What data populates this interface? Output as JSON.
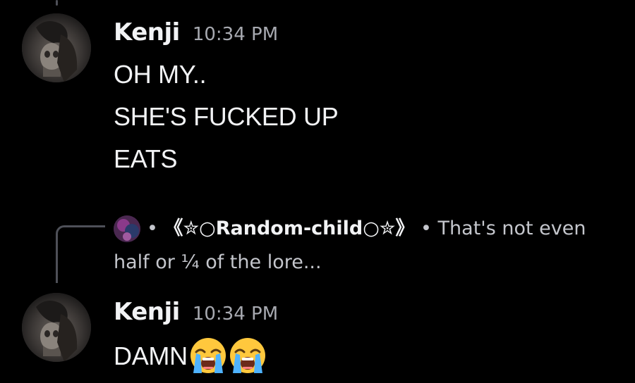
{
  "messages": [
    {
      "username": "Kenji",
      "timestamp": "10:34 PM",
      "lines": [
        "OH MY..",
        "SHE'S FUCKED UP",
        "EATS"
      ]
    },
    {
      "reply": {
        "prefix": "•",
        "name": "《✮○Random-child○✮》",
        "separator": "•",
        "text_part1": "That's not even",
        "text_part2": "half or ¼ of the lore..."
      },
      "username": "Kenji",
      "timestamp": "10:34 PM",
      "text": "DAMN",
      "emojis": [
        "loudly-crying-face",
        "loudly-crying-face"
      ]
    }
  ],
  "colors": {
    "background": "#000000",
    "username": "#f2f3f5",
    "timestamp": "#a7a9b0",
    "thread_line": "#4e5058",
    "reply_text": "#c4c6cc"
  }
}
